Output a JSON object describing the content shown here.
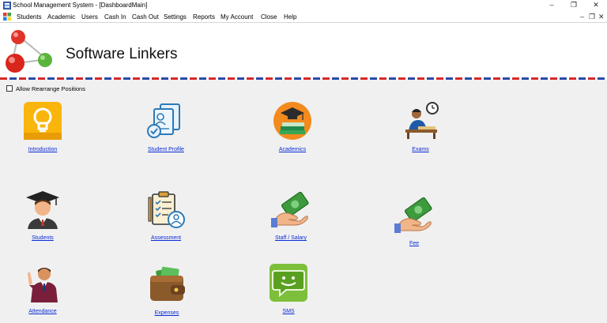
{
  "window": {
    "title": "School Management System - [DashboardMain]",
    "controls": {
      "minimize": "–",
      "restore": "❐",
      "close": "✕"
    }
  },
  "menu": {
    "items": [
      "Students",
      "Academic",
      "Users",
      "Cash In",
      "Cash Out",
      "Settings",
      "Reports",
      "My Account",
      "Close",
      "Help"
    ],
    "mdi_controls": {
      "minimize": "–",
      "restore": "❐",
      "close": "✕"
    }
  },
  "header": {
    "brand": "Software Linkers"
  },
  "options": {
    "rearrange_label": "Allow Rearrange Positions",
    "rearrange_checked": false
  },
  "tiles": {
    "introduction": "Introduction",
    "student_profile": "Student Profile",
    "academics": "Academics",
    "exams": "Exams",
    "students": "Students",
    "assessment": "Assessment",
    "staff_salary": "Staff / Salary",
    "fee": "Fee",
    "attendance": "Attendance",
    "expenses": "Expenses",
    "sms": "SMS"
  },
  "icons": {
    "introduction": "lightbulb-icon",
    "student_profile": "documents-icon",
    "academics": "graduation-books-icon",
    "exams": "student-writing-clock-icon",
    "students": "graduate-student-icon",
    "assessment": "clipboard-user-icon",
    "staff_salary": "hand-cash-icon",
    "fee": "hand-cash-icon",
    "attendance": "waving-person-icon",
    "expenses": "wallet-icon",
    "sms": "chat-bubble-icon"
  },
  "colors": {
    "link": "#0a2bd6",
    "stripe_red": "#d62a2a",
    "stripe_blue": "#2a4aa6",
    "panel_bg": "#f0f0f0"
  }
}
